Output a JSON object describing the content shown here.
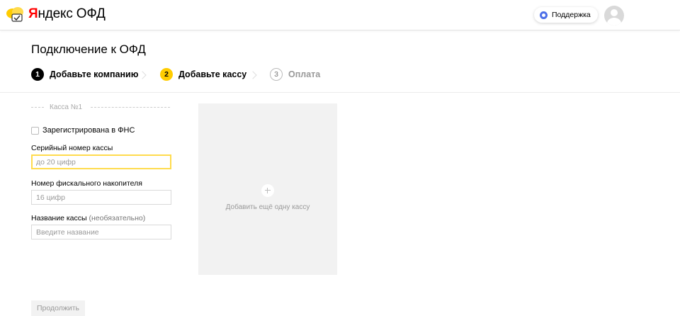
{
  "header": {
    "logo": {
      "brand_red": "Я",
      "brand_rest": "ндекс",
      "product": "ОФД"
    },
    "support_label": "Поддержка",
    "colors": {
      "brand_red": "#ff0000",
      "support_dot": "#4d6fe8"
    }
  },
  "page": {
    "title": "Подключение к ОФД",
    "steps": [
      {
        "number": "1",
        "label": "Добавьте компанию",
        "state": "done"
      },
      {
        "number": "2",
        "label": "Добавьте кассу",
        "state": "active"
      },
      {
        "number": "3",
        "label": "Оплата",
        "state": "pending"
      }
    ],
    "colors": {
      "active_step": "#ffcc00",
      "done_step": "#000000"
    }
  },
  "form": {
    "kassa_title": "Касса №1",
    "registered_label": "Зарегистрирована в ФНС",
    "registered_checked": false,
    "serial": {
      "label": "Серийный номер кассы",
      "placeholder": "до 20 цифр",
      "value": ""
    },
    "fiscal": {
      "label": "Номер фискального накопителя",
      "placeholder": "16 цифр",
      "value": ""
    },
    "name": {
      "label": "Название кассы",
      "optional": "(необязательно)",
      "placeholder": "Введите название",
      "value": ""
    }
  },
  "add_card": {
    "label": "Добавить ещё одну кассу",
    "icon": "plus-icon"
  },
  "continue_label": "Продолжить"
}
